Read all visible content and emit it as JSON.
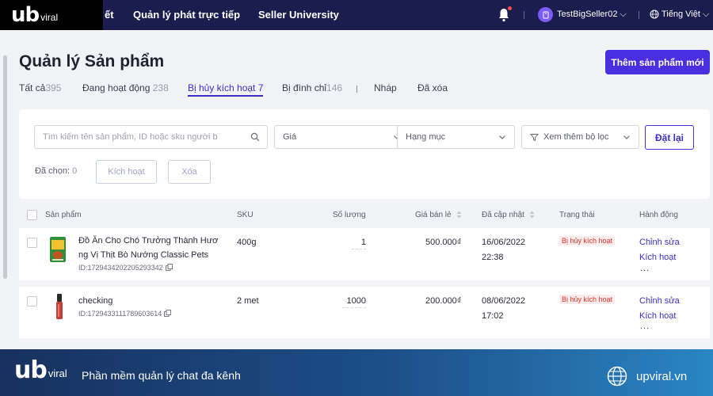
{
  "brand": {
    "logo_mark": "ub",
    "logo_word": "viral"
  },
  "topnav": {
    "items": [
      "ết",
      "Quản lý phát trực tiếp",
      "Seller University"
    ],
    "icons": [
      "bell-icon",
      "user-avatar-icon",
      "chevron-down-icon",
      "globe-icon"
    ],
    "user": "TestBigSeller02",
    "language": "Tiếng Việt"
  },
  "page": {
    "title": "Quản lý Sản phẩm",
    "add_button": "Thêm sản phẩm mới",
    "accent_color": "#4a2fe0"
  },
  "tabs": [
    {
      "label": "Tất cả",
      "count": "395"
    },
    {
      "label": "Đang hoạt động",
      "count": "238"
    },
    {
      "label": "Bị hủy kích hoạt",
      "count": "7",
      "active": true
    },
    {
      "label": "Bị đình chỉ",
      "count": "146"
    },
    {
      "label": "Nháp",
      "count": ""
    },
    {
      "label": "Đã xóa",
      "count": ""
    }
  ],
  "filters": {
    "search_placeholder": "Tìm kiếm tên sản phẩm, ID hoặc sku người b",
    "price": "Giá",
    "category": "Hạng mục",
    "more_filters": "Xem thêm bộ lọc",
    "reset": "Đặt lại",
    "selected_label": "Đã chọn:",
    "selected_count": "0",
    "activate": "Kích hoạt",
    "delete": "Xóa"
  },
  "table": {
    "columns": [
      "Sản phẩm",
      "SKU",
      "Số lượng",
      "Giá bán lẻ",
      "Đã cập nhật",
      "Trạng thái",
      "Hành động"
    ],
    "rows": [
      {
        "name_line1": "Đồ Ăn Cho Chó Trưởng Thành Hươ",
        "name_line2": "ng Vị Thịt Bò Nướng Classic Pets",
        "id": "ID:1729434202205293342",
        "sku": "400g",
        "quantity": "1",
        "price": "500.000₫",
        "date": "16/06/2022",
        "time": "22:38",
        "status": "Bị hủy kích hoạt",
        "action_edit": "Chỉnh sửa",
        "action_activate": "Kích hoạt",
        "action_more": "..."
      },
      {
        "name_line1": "checking",
        "name_line2": "",
        "id": "ID:1729433111789603614",
        "sku": "2 met",
        "quantity": "1000",
        "price": "200.000₫",
        "date": "08/06/2022",
        "time": "17:02",
        "status": "Bị hủy kích hoạt",
        "action_edit": "Chỉnh sửa",
        "action_activate": "Kích hoạt",
        "action_more": "..."
      }
    ],
    "status_color": "#e0342c"
  },
  "banner": {
    "slogan": "Phần mềm quản lý chat đa kênh",
    "site": "upviral.vn"
  }
}
